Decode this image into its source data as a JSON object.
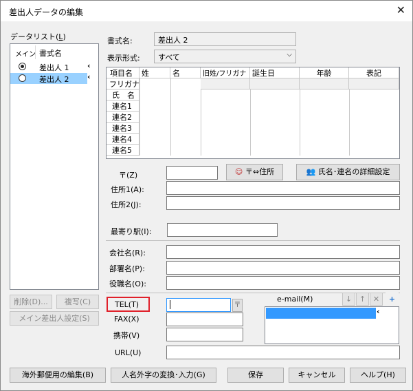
{
  "window": {
    "title": "差出人データの編集",
    "close_glyph": "✕"
  },
  "datalist": {
    "label": "データリスト(",
    "label_key": "L",
    "label_end": ")",
    "col_main": "メイン",
    "col_name": "書式名",
    "items": [
      {
        "name": "差出人 1",
        "main": true,
        "selected": false
      },
      {
        "name": "差出人 2",
        "main": false,
        "selected": true
      }
    ],
    "arrow": "‹"
  },
  "left_buttons": {
    "delete": "削除(D)...",
    "copy": "複写(C)",
    "set_main": "メイン差出人設定(S)"
  },
  "format_name": {
    "label": "書式名:",
    "value": "差出人 2"
  },
  "display_format": {
    "label": "表示形式:",
    "value": "すべて"
  },
  "grid": {
    "headers": [
      "項目名",
      "姓",
      "名",
      "旧姓/フリガナ",
      "誕生日",
      "年齢",
      "表記"
    ],
    "rows": [
      "フリガナ",
      "氏　名",
      "連名1",
      "連名2",
      "連名3",
      "連名4",
      "連名5"
    ]
  },
  "address_tools": {
    "zip_to_addr": "〒⇔住所",
    "name_detail": "氏名･連名の詳細設定"
  },
  "fields": {
    "zip": "〒(Z)",
    "addr1": "住所1(A):",
    "addr2": "住所2(J):",
    "station": "最寄り駅(I):",
    "company": "会社名(R):",
    "dept": "部署名(P):",
    "title": "役職名(O):",
    "tel": "TEL(T)",
    "fax": "FAX(X)",
    "mobile": "携帯(V)",
    "url": "URL(U)",
    "tel_value": "",
    "email_label": "e-mail(M)"
  },
  "email_tools": [
    "↓",
    "↑",
    "✕",
    "+"
  ],
  "bottom_buttons": {
    "overseas": "海外郵便用の編集(B)",
    "convert": "人名外字の変換･入力(G)",
    "save": "保存",
    "cancel": "キャンセル",
    "help": "ヘルプ(H)"
  },
  "colors": {
    "selection": "#99d1ff",
    "highlight": "#3399ff",
    "tel_outline": "#e0202a"
  }
}
